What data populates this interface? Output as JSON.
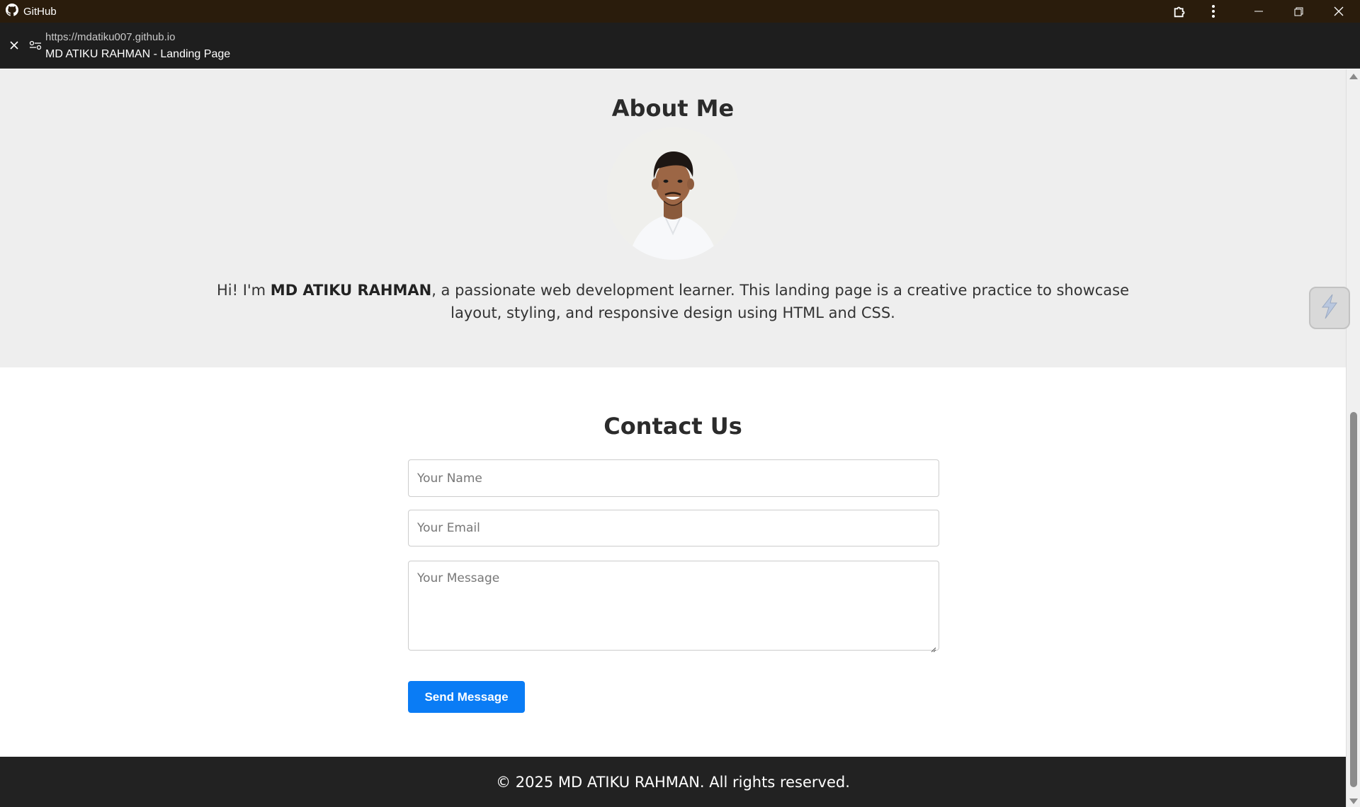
{
  "window": {
    "app_name": "GitHub",
    "icons": [
      "github-logo-icon",
      "extensions-icon",
      "more-vert-icon",
      "minimize-icon",
      "restore-icon",
      "close-icon"
    ]
  },
  "urlbar": {
    "url": "https://mdatiku007.github.io",
    "page_title": "MD ATIKU RAHMAN - Landing Page"
  },
  "about": {
    "heading": "About Me",
    "intro_prefix": "Hi! I'm ",
    "name": "MD ATIKU RAHMAN",
    "intro_suffix": ", a passionate web development learner. This landing page is a creative practice to showcase layout, styling, and responsive design using HTML and CSS."
  },
  "contact": {
    "heading": "Contact Us",
    "name_placeholder": "Your Name",
    "email_placeholder": "Your Email",
    "message_placeholder": "Your Message",
    "send_label": "Send Message"
  },
  "footer": {
    "text": "© 2025 MD ATIKU RAHMAN. All rights reserved."
  },
  "colors": {
    "titlebar": "#2a1c0c",
    "urlbar": "#1e1e1e",
    "about_bg": "#eeeeee",
    "button": "#0a7cf5",
    "footer_bg": "#222222"
  }
}
